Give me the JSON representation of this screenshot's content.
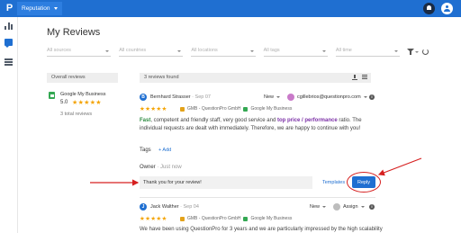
{
  "topbar": {
    "logo": "P",
    "app_name": "Reputation"
  },
  "page": {
    "title": "My Reviews"
  },
  "filters": [
    "All sources",
    "All countries",
    "All locations",
    "All tags",
    "All time"
  ],
  "overall": {
    "header": "Overall reviews",
    "source": "Google My Business",
    "score": "5.0",
    "stars": "★★★★★",
    "total": "3 total reviews"
  },
  "results": {
    "header": "3 reviews found"
  },
  "review1": {
    "initial": "B",
    "author": "Bernhard Strasser",
    "date": " · Sep 07",
    "status": "New",
    "assignee": "cgillebrios@questionpro.com",
    "stars": "★★★★★",
    "place": "GMB - QuestionPro GmbH",
    "source": "Google My Business",
    "text_a": "Fast",
    "text_b": ", competent and friendly staff, very good service and ",
    "text_c": "top price / performance",
    "text_d": " ratio. The individual requests are dealt with immediately. Therefore, we are happy to continue with you!",
    "tags_label": "Tags",
    "add_tag": "+ Add",
    "owner_label": "Owner",
    "owner_time": " · Just now",
    "reply_value": "Thank you for your review!",
    "templates": "Templates",
    "reply_button": "Reply"
  },
  "review2": {
    "initial": "J",
    "author": "Jack Walther",
    "date": " · Sep 04",
    "status": "New",
    "assign": "Assign",
    "stars": "★★★★★",
    "place": "GMB - QuestionPro GmbH",
    "source": "Google My Business",
    "text": "We have been using QuestionPro for 3 years and we are particularly impressed by the high scalability"
  },
  "colors": {
    "brand": "#1f6fd1",
    "star": "#f4a300",
    "annotation": "#d62020",
    "positive": "#2b8a3e",
    "highlight": "#7b2fa6"
  }
}
